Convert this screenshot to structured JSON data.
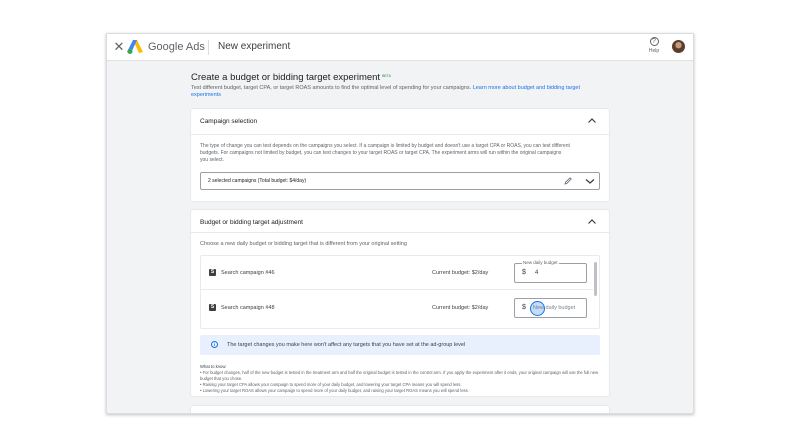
{
  "topbar": {
    "brand": "Google Ads",
    "title": "New experiment",
    "help_label": "Help"
  },
  "page": {
    "heading": "Create a budget or bidding target experiment",
    "beta_badge": "BETA",
    "subtitle": "Test different budget, target CPA, or target ROAS amounts to find the optimal level of spending for your campaigns.",
    "learn_more": "Learn more about budget and bidding target experiments"
  },
  "campaign_selection": {
    "header": "Campaign selection",
    "description": "The type of change you can test depends on the campaigns you select. If a campaign is limited by budget and doesn't use a target CPA or ROAS, you can test different budgets. For campaigns not limited by budget, you can test changes to your target ROAS or target CPA. The experiment arms will run within the original campaigns you select.",
    "selected": "2 selected campaigns (Total budget: $4/day)"
  },
  "budget_adjustment": {
    "header": "Budget or bidding target adjustment",
    "subtitle": "Choose a new daily budget or bidding target that is different from your original setting",
    "rows": [
      {
        "name": "Search campaign #46",
        "current": "Current budget: $2/day",
        "input_label": "New daily budget",
        "currency": "$",
        "value": "4",
        "placeholder": ""
      },
      {
        "name": "Search campaign #48",
        "current": "Current budget: $2/day",
        "input_label": "",
        "currency": "$",
        "value": "",
        "placeholder": "New daily budget"
      }
    ],
    "info": "The target changes you make here won't affect any targets that you have set at the ad-group level",
    "what_to_know_title": "What to know:",
    "what_to_know": [
      "• For budget changes, half of the new budget is tested in the treatment arm and half the original budget is tested in the control arm. If you apply the experiment after it ends, your original campaign will use the full new budget that you chose.",
      "• Raising your target CPA allows your campaign to spend more of your daily budget, and lowering your target CPA means you will spend less.",
      "• Lowering your target ROAS allows your campaign to spend more of your daily budget, and raising your target ROAS means you will spend less."
    ]
  },
  "icons": {
    "close": "close-icon",
    "logo": "google-ads-logo-icon",
    "help": "help-icon",
    "edit": "pencil-icon",
    "expand": "chevron-down-icon",
    "collapse": "chevron-up-icon",
    "info": "info-icon",
    "search_campaign": "search-campaign-icon"
  },
  "colors": {
    "accent": "#1a73e8",
    "beta": "#1e8e3e",
    "info_bg": "#e8f0fe"
  }
}
